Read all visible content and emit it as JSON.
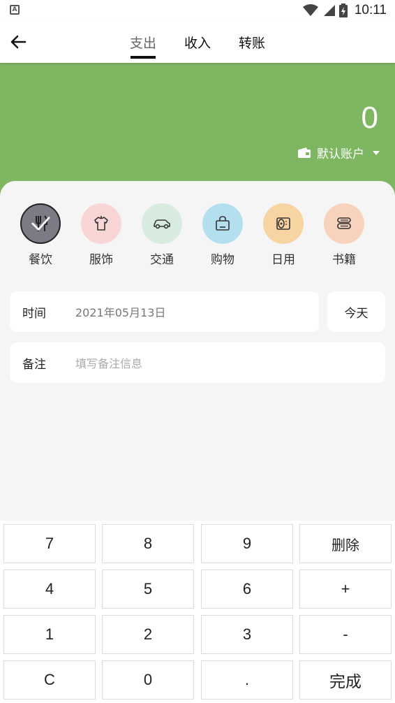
{
  "status_bar": {
    "time": "10:11",
    "app_icon_letter": "A"
  },
  "nav": {
    "back_icon": "arrow-left-icon",
    "tabs": [
      {
        "label": "支出",
        "active": true
      },
      {
        "label": "收入",
        "active": false
      },
      {
        "label": "转账",
        "active": false
      }
    ]
  },
  "header": {
    "amount": "0",
    "account_label": "默认账户",
    "color": "#7fb662"
  },
  "categories": [
    {
      "label": "餐饮",
      "icon": "fork-knife-icon",
      "selected": true
    },
    {
      "label": "服饰",
      "icon": "shirt-icon",
      "selected": false
    },
    {
      "label": "交通",
      "icon": "car-icon",
      "selected": false
    },
    {
      "label": "购物",
      "icon": "shopping-bag-icon",
      "selected": false
    },
    {
      "label": "日用",
      "icon": "toilet-paper-icon",
      "selected": false
    },
    {
      "label": "书籍",
      "icon": "books-icon",
      "selected": false
    }
  ],
  "form": {
    "time_label": "时间",
    "time_value": "2021年05月13日",
    "today_button": "今天",
    "note_label": "备注",
    "note_placeholder": "填写备注信息"
  },
  "keypad": {
    "keys": [
      [
        "7",
        "8",
        "9",
        "删除"
      ],
      [
        "4",
        "5",
        "6",
        "+"
      ],
      [
        "1",
        "2",
        "3",
        "-"
      ],
      [
        "C",
        "0",
        ".",
        "完成"
      ]
    ]
  }
}
